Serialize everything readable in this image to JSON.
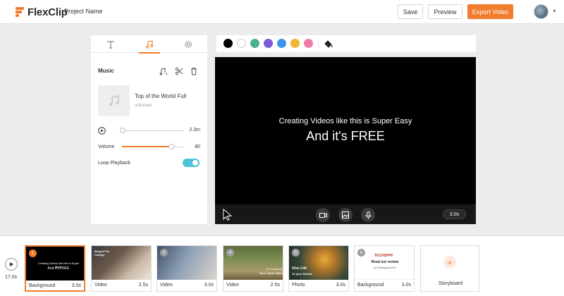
{
  "topbar": {
    "logo_text": "FlexClip",
    "project_name": "Project Name",
    "save_label": "Save",
    "preview_label": "Preview",
    "export_label": "Export Video",
    "accent_color": "#f07c2d"
  },
  "left_panel": {
    "tabs": [
      "text-tab",
      "music-tab",
      "settings-tab"
    ],
    "active_tab": "music-tab",
    "section_title": "Music",
    "track": {
      "title": "Top of the World Full",
      "artist": "unknown",
      "duration": "2.3m",
      "progress": 0.0
    },
    "volume": {
      "label": "Volume",
      "value": "80"
    },
    "loop": {
      "label": "Loop Playback",
      "enabled": true
    }
  },
  "color_bar": {
    "swatches": [
      "#000000",
      "#ffffff",
      "#4caf8f",
      "#7e5bd6",
      "#3a97e8",
      "#f2b632",
      "#ee7aa8"
    ]
  },
  "stage": {
    "line1": "Creating Videos like this is Super Easy",
    "line2": "And it's FREE",
    "duration": "3.0s"
  },
  "timeline": {
    "total": "17.0s",
    "clips": [
      {
        "num": "1",
        "type": "Background",
        "dur": "3.0s",
        "selected": true
      },
      {
        "num": "2",
        "type": "Video",
        "dur": "2.5s",
        "selected": false
      },
      {
        "num": "3",
        "type": "Video",
        "dur": "3.0s",
        "selected": false
      },
      {
        "num": "4",
        "type": "Video",
        "dur": "2.5s",
        "selected": false
      },
      {
        "num": "5",
        "type": "Photo",
        "dur": "3.0s",
        "selected": false
      },
      {
        "num": "6",
        "type": "Background",
        "dur": "3.0s",
        "selected": false
      }
    ],
    "thumb_text": {
      "clip1_a": "Creating Videos like this is Super Easy",
      "clip1_b": "And it's FREE",
      "clip2": "Bring It For College",
      "clip4_a": "Or it could be",
      "clip4_b": "Your Travel Video",
      "clip5_a": "Give Life",
      "clip5_b": "To your Stories",
      "clip6_logo": "TECHSPPF",
      "clip6_a": "Read our review",
      "clip6_b": "at Techspppf.com"
    },
    "storyboard_label": "Storyboard"
  }
}
